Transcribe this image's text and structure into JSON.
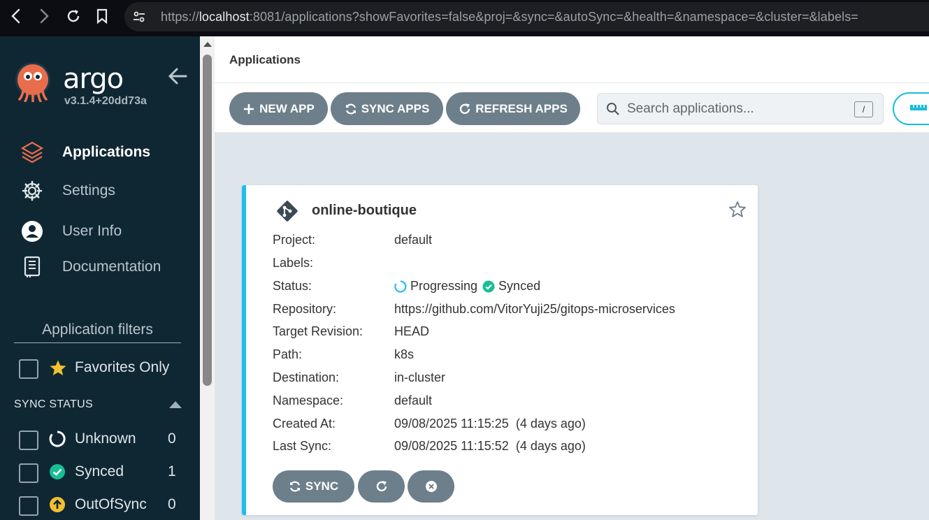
{
  "browser": {
    "url_scheme": "https://",
    "url_host": "localhost",
    "url_rest": ":8081/applications?showFavorites=false&proj=&sync=&autoSync=&health=&namespace=&cluster=&labels="
  },
  "sidebar": {
    "brand": "argo",
    "version": "v3.1.4+20dd73a",
    "nav": [
      {
        "label": "Applications",
        "icon": "layers-icon"
      },
      {
        "label": "Settings",
        "icon": "gear-icon"
      },
      {
        "label": "User Info",
        "icon": "user-icon"
      },
      {
        "label": "Documentation",
        "icon": "book-icon"
      }
    ],
    "filters_title": "Application filters",
    "favorites_label": "Favorites Only",
    "sync_status_header": "SYNC STATUS",
    "sync_filters": [
      {
        "label": "Unknown",
        "count": "0",
        "icon": "unknown-circle-icon"
      },
      {
        "label": "Synced",
        "count": "1",
        "icon": "check-circle-icon"
      },
      {
        "label": "OutOfSync",
        "count": "0",
        "icon": "arrow-up-circle-icon"
      }
    ]
  },
  "main": {
    "title": "Applications",
    "toolbar": {
      "new_app": "NEW APP",
      "sync_apps": "SYNC APPS",
      "refresh_apps": "REFRESH APPS",
      "search_placeholder": "Search applications...",
      "search_shortcut": "/"
    }
  },
  "card": {
    "name": "online-boutique",
    "rows": [
      {
        "key": "Project:",
        "value": "default"
      },
      {
        "key": "Labels:",
        "value": ""
      },
      {
        "key": "Status:",
        "health": "Progressing",
        "sync": "Synced"
      },
      {
        "key": "Repository:",
        "value": "https://github.com/VitorYuji25/gitops-microservices"
      },
      {
        "key": "Target Revision:",
        "value": "HEAD"
      },
      {
        "key": "Path:",
        "value": "k8s"
      },
      {
        "key": "Destination:",
        "value": "in-cluster"
      },
      {
        "key": "Namespace:",
        "value": "default"
      },
      {
        "key": "Created At:",
        "value": "09/08/2025 11:15:25  (4 days ago)"
      },
      {
        "key": "Last Sync:",
        "value": "09/08/2025 11:15:52  (4 days ago)"
      }
    ],
    "sync_button": "SYNC"
  },
  "colors": {
    "sidebar_bg": "#0f2733",
    "button_bg": "#6d7f8b",
    "accent_cyan": "#1fbdf0",
    "synced_green": "#18be94",
    "outofsync_yellow": "#f4c030",
    "argo_orange": "#e96d4c"
  }
}
